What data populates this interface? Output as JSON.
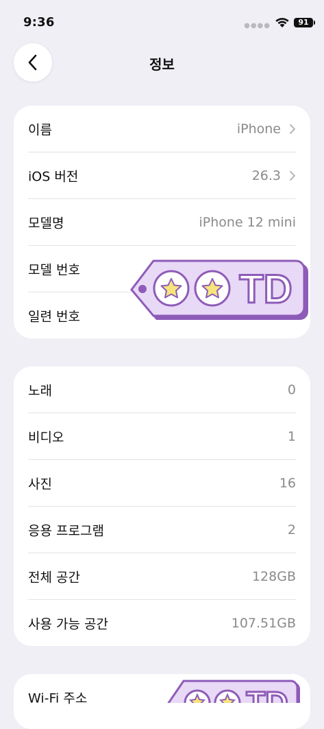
{
  "status": {
    "time": "9:36",
    "battery": "91"
  },
  "nav": {
    "title": "정보",
    "back_icon": "chevron-left-icon"
  },
  "device": {
    "rows": [
      {
        "label": "이름",
        "value": "iPhone"
      },
      {
        "label": "iOS 버전",
        "value": "26.3"
      },
      {
        "label": "모델명",
        "value": "iPhone 12 mini"
      },
      {
        "label": "모델 번호",
        "value": ""
      },
      {
        "label": "일련 번호",
        "value": ""
      }
    ]
  },
  "media": {
    "rows": [
      {
        "label": "노래",
        "value": "0"
      },
      {
        "label": "비디오",
        "value": "1"
      },
      {
        "label": "사진",
        "value": "16"
      },
      {
        "label": "응용 프로그램",
        "value": "2"
      },
      {
        "label": "전체 공간",
        "value": "128GB"
      },
      {
        "label": "사용 가능 공간",
        "value": "107.51GB"
      }
    ]
  },
  "network": {
    "rows": [
      {
        "label": "Wi-Fi 주소",
        "value": ""
      }
    ]
  },
  "sticker": {
    "text": "TD",
    "accent": "#8e5bb8",
    "fill": "#e8d9f6"
  }
}
